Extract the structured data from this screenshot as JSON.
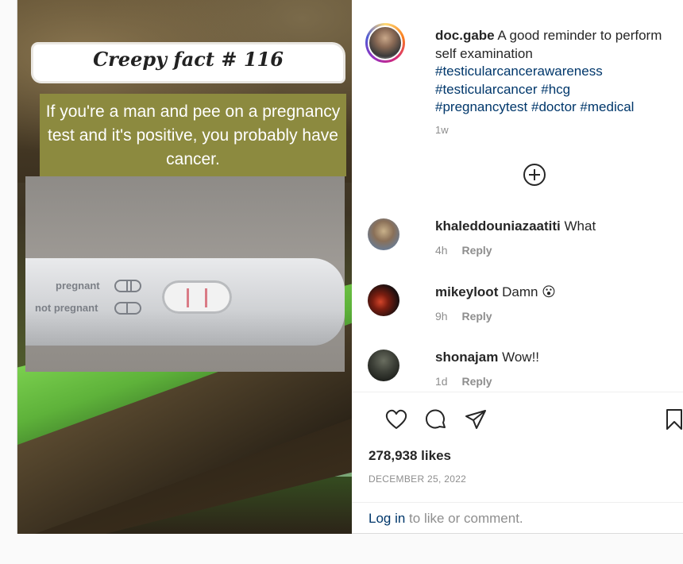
{
  "post_image": {
    "fact_title": "Creepy fact # 116",
    "fact_text": "If you're a man and pee on a pregnancy test and it's positive, you probably have cancer.",
    "test_label_pregnant": "pregnant",
    "test_label_not_pregnant": "not pregnant"
  },
  "author": {
    "username": "doc.gabe",
    "caption_text": "A good reminder to perform self examination",
    "hashtags": [
      "#testicularcancerawareness",
      "#testicularcancer",
      "#hcg",
      "#pregnancytest",
      "#doctor",
      "#medical"
    ],
    "time": "1w"
  },
  "comments": [
    {
      "username": "khaleddouniazaatiti",
      "text": "What",
      "time": "4h",
      "reply": "Reply",
      "avatar_color": "#6b7a8f"
    },
    {
      "username": "mikeyloot",
      "text": "Damn 😮",
      "time": "9h",
      "reply": "Reply",
      "avatar_color": "#1c1010"
    },
    {
      "username": "shonajam",
      "text": "Wow!!",
      "time": "1d",
      "reply": "Reply",
      "avatar_color": "#3b3e36"
    }
  ],
  "icons": [
    "plus-circle-icon",
    "heart-icon",
    "comment-icon",
    "share-icon",
    "bookmark-icon"
  ],
  "likes": "278,938 likes",
  "date": "DECEMBER 25, 2022",
  "login": {
    "link": "Log in",
    "rest": " to like or comment."
  }
}
